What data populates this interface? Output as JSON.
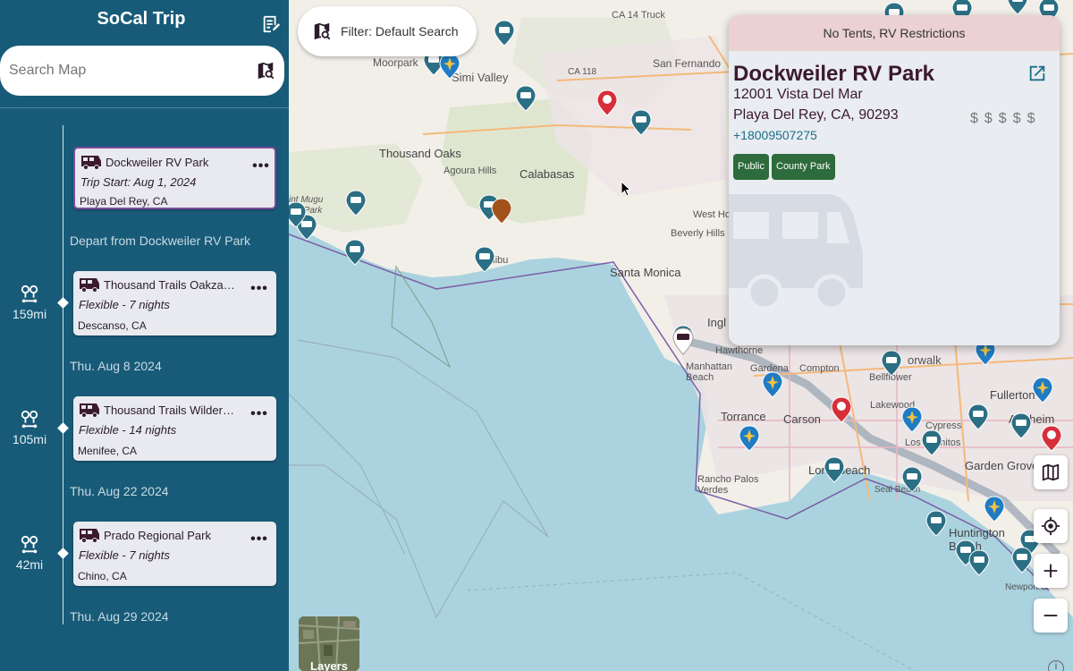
{
  "sidebar": {
    "title": "SoCal Trip",
    "search_placeholder": "Search Map",
    "depart_label": "Depart from Dockweiler RV Park",
    "stops": [
      {
        "name": "Dockweiler RV Park",
        "sub": "Trip Start: Aug 1, 2024",
        "location": "Playa Del Rey, CA",
        "more": "•••"
      },
      {
        "name": "Thousand Trails Oakzanita",
        "sub": "Flexible - 7 nights",
        "location": "Descanso, CA",
        "more": "•••"
      },
      {
        "name": "Thousand Trails Wilderness Lakes",
        "sub": "Flexible - 14 nights",
        "location": "Menifee, CA",
        "more": "•••"
      },
      {
        "name": "Prado Regional Park",
        "sub": "Flexible - 7 nights",
        "location": "Chino, CA",
        "more": "•••"
      }
    ],
    "distances": [
      "159mi",
      "105mi",
      "42mi"
    ],
    "dates": [
      "Thu. Aug 8 2024",
      "Thu. Aug 22 2024",
      "Thu. Aug 29 2024"
    ]
  },
  "filter": {
    "label": "Filter: Default Search"
  },
  "popup": {
    "banner": "No Tents, RV Restrictions",
    "title": "Dockweiler RV Park",
    "address_line1": "12001 Vista Del Mar",
    "address_line2": "Playa Del Rey, CA, 90293",
    "phone": "+18009507275",
    "price": "$$$$$",
    "tags": [
      "Public",
      "County Park"
    ]
  },
  "map": {
    "layers_label": "Layers",
    "info_label": "i",
    "labels": {
      "ca14": "CA 14 Truck",
      "moorpark": "Moorpark",
      "san_fernando": "San Fernando",
      "simi_valley": "Simi Valley",
      "ca118": "CA 118",
      "thousand_oaks": "Thousand Oaks",
      "agoura_hills": "Agoura Hills",
      "calabasas": "Calabasas",
      "west_ho": "West Ho",
      "beverly_hills": "Beverly Hills",
      "malibu": "Malibu",
      "santa_monica": "Santa Monica",
      "point_mugu": "int Mugu",
      "ate_park": "ate Park",
      "inglewood": "Ingl",
      "hawthorne": "Hawthorne",
      "gardena": "Gardena",
      "compton": "Compton",
      "norwalk": "orwalk",
      "bellflower": "Bellflower",
      "fullerton": "Fullerton",
      "manhattan_beach": "Manhattan Beach",
      "torrance": "Torrance",
      "carson": "Carson",
      "lakewood": "Lakewood",
      "cypress": "Cypress",
      "los_alamitos": "Los Alamitos",
      "anaheim": "Anaheim",
      "long_beach": "Long Beach",
      "garden_grove": "Garden Grove",
      "rancho_palos_verdes": "Rancho Palos Verdes",
      "seal_beach": "Seal Beach",
      "huntington_beach": "Huntington Beach",
      "newport": "Newport C"
    }
  },
  "colors": {
    "sidebar_bg": "#185b78",
    "card_bg": "#e8eaef",
    "selected_border": "#7e4b9c",
    "tag_green": "#2e6b3c",
    "banner_pink": "#ebd1d1",
    "water": "#aad3df"
  },
  "icons": {
    "notes": "notes-icon",
    "map_search": "map-search-icon",
    "rv": "rv-icon",
    "distance": "distance-route-icon",
    "filter": "map-filter-icon",
    "open": "open-external-icon",
    "map_view": "map-icon",
    "locate": "locate-icon",
    "zoom_in": "plus-icon",
    "zoom_out": "minus-icon"
  }
}
